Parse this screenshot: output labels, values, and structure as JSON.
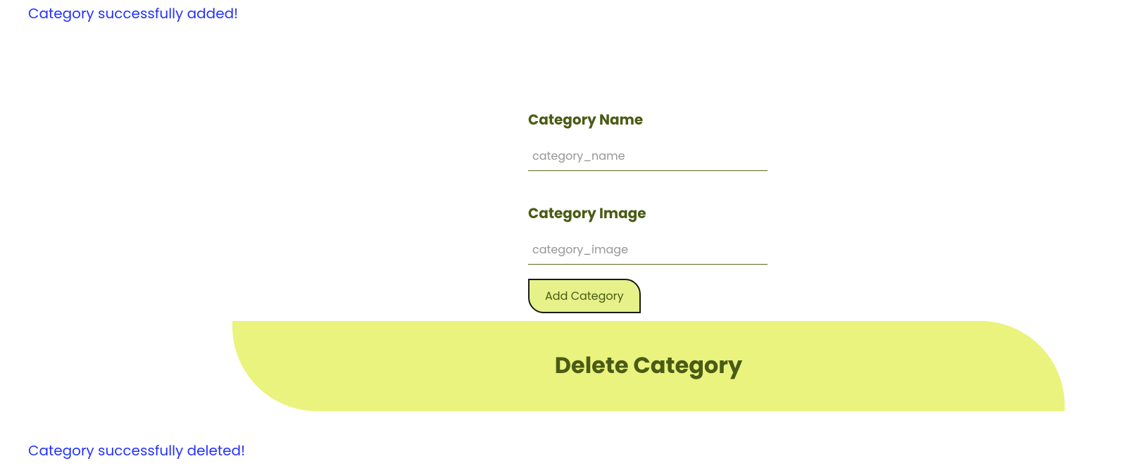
{
  "messages": {
    "added": "Category successfully added!",
    "deleted": "Category successfully deleted!"
  },
  "form": {
    "name_label": "Category Name",
    "name_placeholder": "category_name",
    "image_label": "Category Image",
    "image_placeholder": "category_image",
    "add_button": "Add Category"
  },
  "delete_section": {
    "heading": "Delete Category"
  }
}
